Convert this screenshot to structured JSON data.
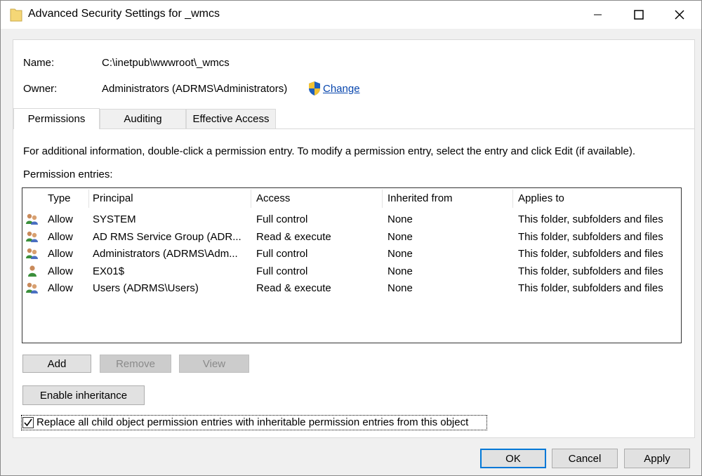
{
  "window": {
    "title": "Advanced Security Settings for _wmcs"
  },
  "name_row": {
    "label": "Name:",
    "value": "C:\\inetpub\\wwwroot\\_wmcs"
  },
  "owner_row": {
    "label": "Owner:",
    "value": "Administrators (ADRMS\\Administrators)",
    "change_link": "Change"
  },
  "tabs": [
    {
      "label": "Permissions",
      "active": true
    },
    {
      "label": "Auditing",
      "active": false
    },
    {
      "label": "Effective Access",
      "active": false
    }
  ],
  "info_text": "For additional information, double-click a permission entry. To modify a permission entry, select the entry and click Edit (if available).",
  "entries_label": "Permission entries:",
  "table": {
    "headers": [
      "Type",
      "Principal",
      "Access",
      "Inherited from",
      "Applies to"
    ],
    "rows": [
      {
        "icon": "group-users-icon",
        "type": "Allow",
        "principal": "SYSTEM",
        "access": "Full control",
        "inherited": "None",
        "applies": "This folder, subfolders and files"
      },
      {
        "icon": "group-users-icon",
        "type": "Allow",
        "principal": "AD RMS Service Group (ADR...",
        "access": "Read & execute",
        "inherited": "None",
        "applies": "This folder, subfolders and files"
      },
      {
        "icon": "group-users-icon",
        "type": "Allow",
        "principal": "Administrators (ADRMS\\Adm...",
        "access": "Full control",
        "inherited": "None",
        "applies": "This folder, subfolders and files"
      },
      {
        "icon": "single-user-icon",
        "type": "Allow",
        "principal": "EX01$",
        "access": "Full control",
        "inherited": "None",
        "applies": "This folder, subfolders and files"
      },
      {
        "icon": "group-users-icon",
        "type": "Allow",
        "principal": "Users (ADRMS\\Users)",
        "access": "Read & execute",
        "inherited": "None",
        "applies": "This folder, subfolders and files"
      }
    ]
  },
  "buttons": {
    "add": "Add",
    "remove": "Remove",
    "view": "View",
    "enable_inheritance": "Enable inheritance"
  },
  "replace_checkbox": {
    "label": "Replace all child object permission entries with inheritable permission entries from this object",
    "checked": true
  },
  "footer": {
    "ok": "OK",
    "cancel": "Cancel",
    "apply": "Apply"
  },
  "colors": {
    "link": "#0645ad",
    "focus_border": "#0078d7",
    "window_bg": "#f0f0f0"
  }
}
